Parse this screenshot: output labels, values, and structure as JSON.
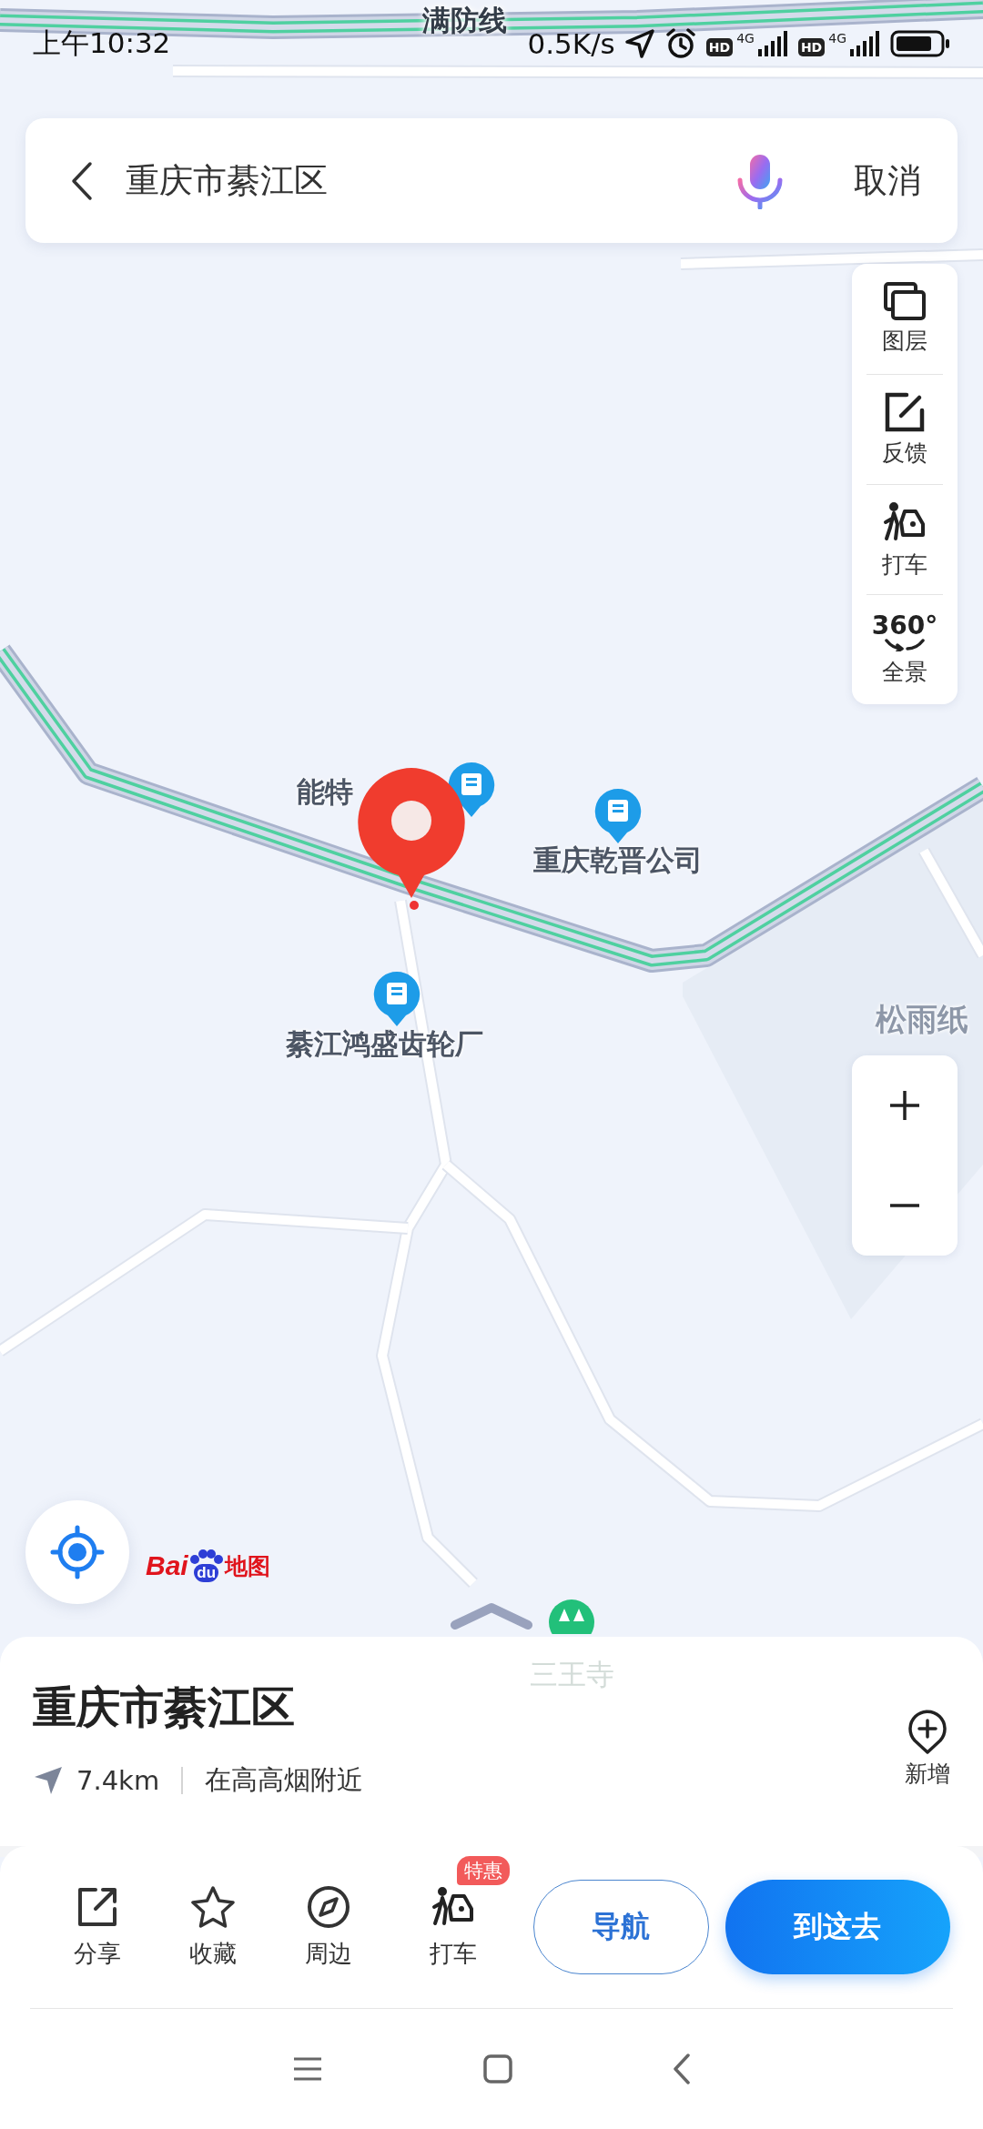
{
  "status_bar": {
    "time": "上午10:32",
    "speed": "0.5K/s",
    "sims": [
      {
        "hd": "HD",
        "network": "4G"
      },
      {
        "hd": "HD",
        "network": "4G"
      }
    ]
  },
  "search_bar": {
    "query": "重庆市綦江区",
    "cancel": "取消"
  },
  "map_tools": [
    {
      "label": "图层",
      "kind": "layers"
    },
    {
      "label": "反馈",
      "kind": "feedback"
    },
    {
      "label": "打车",
      "kind": "taxi"
    },
    {
      "label": "全景",
      "kind": "panorama",
      "icon_text": "360°"
    }
  ],
  "map_labels": [
    {
      "text": "满防线",
      "kind": "road"
    },
    {
      "text": "能特",
      "kind": "poi"
    },
    {
      "text": "重庆乾晋公司",
      "kind": "poi"
    },
    {
      "text": "綦江鸿盛齿轮厂",
      "kind": "poi"
    },
    {
      "text": "松雨纸",
      "kind": "area"
    },
    {
      "text": "三王寺",
      "kind": "scenic"
    }
  ],
  "logo": {
    "latin": "Bai",
    "paw": "du",
    "cjk": "地图"
  },
  "place": {
    "name": "重庆市綦江区",
    "distance": "7.4km",
    "nearby": "在高高烟附近",
    "add_label": "新增"
  },
  "actions": [
    {
      "label": "分享",
      "kind": "share"
    },
    {
      "label": "收藏",
      "kind": "favorite"
    },
    {
      "label": "周边",
      "kind": "nearby"
    },
    {
      "label": "打车",
      "kind": "taxi",
      "badge": "特惠"
    }
  ],
  "buttons": {
    "secondary": "导航",
    "primary": "到这去"
  }
}
